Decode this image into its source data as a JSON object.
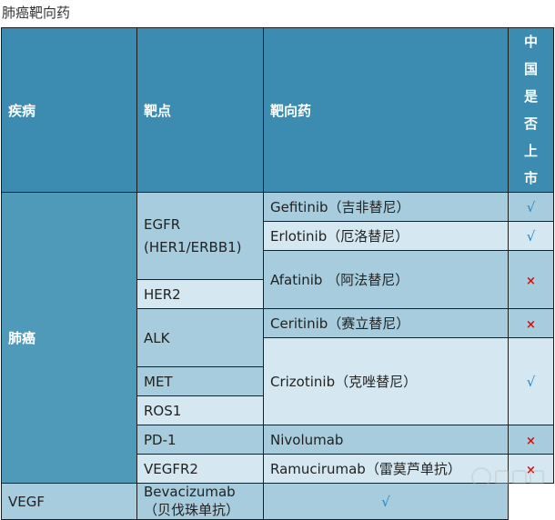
{
  "page_title": "肺癌靶向药",
  "header": {
    "disease": "疾病",
    "target": "靶点",
    "drug": "靶向药",
    "approved_chars": [
      "中",
      "国",
      "是",
      "否",
      "上",
      "市"
    ]
  },
  "disease": "肺癌",
  "targets": [
    "EGFR (HER1/ERBB1)",
    "HER2",
    "ALK",
    "MET",
    "ROS1",
    "PD-1",
    "VEGFR2",
    "VEGF"
  ],
  "drugs": [
    "Gefitinib（吉非替尼）",
    "Erlotinib（厄洛替尼）",
    "Afatinib （阿法替尼）",
    "Ceritinib（赛立替尼）",
    "Crizotinib（克唑替尼）",
    "Nivolumab",
    "Ramucirumab（雷莫芦单抗）",
    "Bevacizumab（贝伐珠单抗）"
  ],
  "approved": [
    "√",
    "√",
    "×",
    "×",
    "√",
    "×",
    "×",
    "√"
  ],
  "colors": {
    "header_bg": "#3c8bb0",
    "cell_dark": "#a6ccdd",
    "cell_light": "#d5e8f1",
    "check": "#2a86c0",
    "cross": "#d01010"
  }
}
